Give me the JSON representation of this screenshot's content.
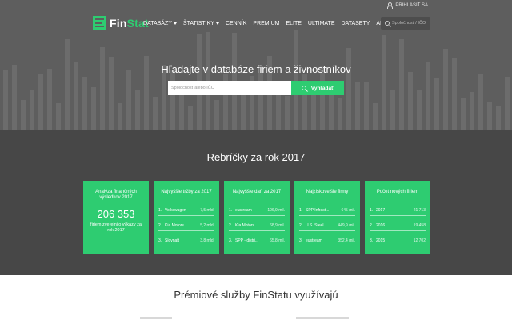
{
  "header": {
    "login_label": "PRIHLÁSIŤ SA",
    "brand": {
      "part1": "Fin",
      "part2": "Stat",
      "accent_color": "#2ecc71"
    },
    "nav": [
      {
        "label": "DATABÁZY",
        "dropdown": true
      },
      {
        "label": "ŠTATISTIKY",
        "dropdown": true
      },
      {
        "label": "CENNÍK"
      },
      {
        "label": "PREMIUM"
      },
      {
        "label": "ELITE"
      },
      {
        "label": "ULTIMATE"
      },
      {
        "label": "DATASETY"
      },
      {
        "label": "API"
      }
    ],
    "search_placeholder": "Spoločnosť / IČO"
  },
  "hero": {
    "title": "Hľadajte v databáze firiem a živnostníkov",
    "search_placeholder": "Spoločnosť alebo IČO",
    "search_button": "Vyhľadať"
  },
  "rankings": {
    "title": "Rebríčky za rok 2017",
    "cards": [
      {
        "title": "Analýza finančných výsledkov 2017",
        "big_number": "206 353",
        "note": "firiem zverejnilo výkazy za rok 2017"
      },
      {
        "title": "Najvyššie tržby za 2017",
        "rows": [
          {
            "rank": "1.",
            "name": "Volkswagen",
            "value": "7,5 mld."
          },
          {
            "rank": "2.",
            "name": "Kia Motors",
            "value": "5,2 mld."
          },
          {
            "rank": "3.",
            "name": "Slovnaft",
            "value": "3,8 mld."
          }
        ]
      },
      {
        "title": "Najvyššie daň za 2017",
        "rows": [
          {
            "rank": "1.",
            "name": "eustream",
            "value": "106,9 mil."
          },
          {
            "rank": "2.",
            "name": "Kia Motors",
            "value": "68,9 mil."
          },
          {
            "rank": "3.",
            "name": "SPP - distri...",
            "value": "65,8 mil."
          }
        ]
      },
      {
        "title": "Najziskovejšie firmy",
        "rows": [
          {
            "rank": "1.",
            "name": "SPP Infrast...",
            "value": "645 mil."
          },
          {
            "rank": "2.",
            "name": "U.S. Steel",
            "value": "449,9 mil."
          },
          {
            "rank": "3.",
            "name": "eustream",
            "value": "352,4 mil."
          }
        ]
      },
      {
        "title": "Počet nových firiem",
        "rows": [
          {
            "rank": "1.",
            "name": "2017",
            "value": "21 713"
          },
          {
            "rank": "2.",
            "name": "2016",
            "value": "19 458"
          },
          {
            "rank": "3.",
            "name": "2015",
            "value": "12 702"
          }
        ]
      }
    ]
  },
  "premium": {
    "title": "Prémiové služby FinStatu využívajú"
  }
}
